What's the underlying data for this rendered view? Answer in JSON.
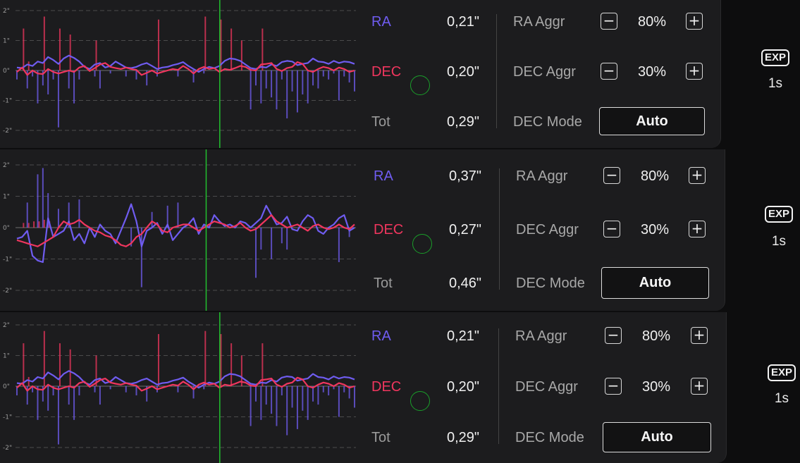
{
  "colors": {
    "ra": "#6f5cf0",
    "dec": "#f0365e",
    "cursor": "#22c02f",
    "grid": "#777777"
  },
  "rows": [
    {
      "chart": {
        "yticks": [
          "2\"",
          "1\"",
          "0\"",
          "-1\"",
          "-2\""
        ],
        "ra_line": [
          0.1,
          0.08,
          0.2,
          0.15,
          0.3,
          0.25,
          0.45,
          0.35,
          0.22,
          0.4,
          0.5,
          0.42,
          0.3,
          0.12,
          0.05,
          0.2,
          0.25,
          0.1,
          0.15,
          0.3,
          0.2,
          0.1,
          0.08,
          0.12,
          0.2,
          0.25,
          0.15,
          0.05,
          0.1,
          0.12,
          0.18,
          0.22,
          0.28,
          0.15,
          0.05,
          -0.05,
          0.05,
          0.12,
          0.08,
          0.15,
          0.32,
          0.4,
          0.38,
          0.32,
          0.2,
          0.08,
          0.05,
          0.12,
          0.1,
          0.2,
          0.15,
          0.28,
          0.32,
          0.3,
          0.18,
          0.22,
          0.25,
          0.4,
          0.3,
          0.28,
          0.22,
          0.32,
          0.25,
          0.3,
          0.28,
          0.22
        ],
        "dec_line": [
          -0.05,
          0.1,
          -0.15,
          0.0,
          -0.1,
          -0.12,
          0.05,
          -0.05,
          -0.1,
          -0.05,
          0.0,
          -0.05,
          0.1,
          0.15,
          -0.02,
          0.08,
          0.2,
          0.25,
          0.12,
          0.08,
          0.05,
          0.1,
          0.05,
          0.02,
          -0.15,
          -0.08,
          0.0,
          -0.1,
          -0.05,
          0.0,
          0.05,
          0.02,
          0.15,
          0.05,
          -0.1,
          0.05,
          0.12,
          0.05,
          0.08,
          -0.05,
          0.05,
          0.02,
          0.08,
          0.15,
          0.12,
          0.02,
          0.0,
          0.2,
          0.22,
          0.25,
          0.05,
          -0.02,
          0.08,
          0.12,
          0.28,
          0.22,
          0.0,
          -0.05,
          0.05,
          0.12,
          0.08,
          0.0,
          0.1,
          0.05,
          -0.05,
          0.0
        ],
        "ra_bars": [
          -0.3,
          0.0,
          -0.6,
          -0.2,
          -1.1,
          -0.5,
          -0.8,
          -0.3,
          -1.9,
          0.0,
          -0.6,
          -1.1,
          -0.3,
          0.0,
          0.0,
          -0.2,
          -0.6,
          0.0,
          -0.1,
          0.0,
          0.0,
          -0.2,
          0.0,
          -0.3,
          0.0,
          -0.5,
          0.0,
          -0.2,
          0.0,
          0.0,
          0.0,
          -0.2,
          0.0,
          0.0,
          -0.4,
          0.0,
          -0.1,
          0.0,
          0.0,
          0.0,
          0.0,
          0.0,
          0.0,
          0.0,
          0.0,
          -1.3,
          -0.5,
          -1.1,
          -0.6,
          -0.9,
          -1.3,
          -0.3,
          -1.6,
          -0.7,
          -1.4,
          -0.8,
          -1.1,
          -0.5,
          -0.6,
          -0.2,
          -0.3,
          -0.1,
          -1.0,
          -0.2,
          -0.4,
          -0.7
        ],
        "dec_bars": [
          0.0,
          1.4,
          0.3,
          0.0,
          0.0,
          1.8,
          0.0,
          0.0,
          1.4,
          0.0,
          1.2,
          0.0,
          0.0,
          0.0,
          0.0,
          1.0,
          0.0,
          0.0,
          0.0,
          0.0,
          0.0,
          0.0,
          0.0,
          0.0,
          0.0,
          0.0,
          0.0,
          1.7,
          0.0,
          0.0,
          0.0,
          0.0,
          0.0,
          0.0,
          0.0,
          0.0,
          1.8,
          0.0,
          0.0,
          1.7,
          0.0,
          1.4,
          0.0,
          1.0,
          0.0,
          0.0,
          0.0,
          1.4,
          0.0,
          0.0,
          0.0,
          0.0,
          0.0,
          0.0,
          0.0,
          0.0,
          0.0,
          0.0,
          0.0,
          0.0,
          0.0,
          0.0,
          0.0,
          0.0,
          0.0,
          0.0
        ],
        "cursor_frac": 0.6
      },
      "ra_label": "RA",
      "ra_value": "0,21\"",
      "dec_label": "DEC",
      "dec_value": "0,20\"",
      "tot_label": "Tot",
      "tot_value": "0,29\"",
      "ra_aggr_label": "RA Aggr",
      "ra_aggr_minus": "−",
      "ra_aggr_value": "80%",
      "ra_aggr_plus": "+",
      "dec_aggr_label": "DEC Aggr",
      "dec_aggr_minus": "−",
      "dec_aggr_value": "30%",
      "dec_aggr_plus": "+",
      "dec_mode_label": "DEC Mode",
      "dec_mode_value": "Auto",
      "exp_icon": "EXP",
      "exp_value": "1s"
    },
    {
      "chart": {
        "yticks": [
          "2\"",
          "1\"",
          "0\"",
          "-1\"",
          "-2\""
        ],
        "ra_line": [
          -0.35,
          -0.3,
          -0.1,
          -0.9,
          -1.05,
          -1.1,
          0.3,
          -0.3,
          -0.2,
          -0.1,
          0.2,
          -0.4,
          -0.2,
          -0.5,
          0.0,
          -0.3,
          0.1,
          -0.1,
          -0.2,
          -0.5,
          -0.1,
          0.3,
          0.75,
          0.2,
          -0.6,
          -0.1,
          0.0,
          0.15,
          -0.2,
          0.1,
          -0.4,
          -0.2,
          0.0,
          0.1,
          0.3,
          -0.2,
          0.1,
          0.0,
          0.4,
          0.2,
          0.05,
          0.1,
          0.0,
          0.2,
          0.15,
          0.0,
          0.15,
          0.3,
          0.7,
          0.4,
          0.1,
          0.15,
          0.35,
          -0.05,
          -0.1,
          0.2,
          0.4,
          0.3,
          -0.1,
          -0.2,
          0.0,
          0.1,
          0.3,
          0.4,
          -0.1,
          0.0
        ],
        "dec_line": [
          -0.4,
          -0.45,
          -0.5,
          -0.55,
          -0.6,
          -0.5,
          -0.4,
          -0.3,
          0.0,
          0.2,
          0.1,
          0.15,
          0.25,
          0.1,
          0.0,
          -0.1,
          -0.15,
          -0.25,
          -0.3,
          -0.4,
          -0.55,
          -0.6,
          -0.5,
          -0.3,
          -0.2,
          0.0,
          0.2,
          0.1,
          -0.1,
          -0.15,
          0.0,
          0.05,
          0.1,
          0.1,
          0.0,
          -0.1,
          0.0,
          0.1,
          0.2,
          0.15,
          0.1,
          0.0,
          0.05,
          0.15,
          0.0,
          -0.1,
          -0.05,
          0.1,
          0.25,
          0.4,
          0.2,
          0.1,
          0.0,
          0.05,
          0.1,
          0.0,
          -0.1,
          0.05,
          0.1,
          0.0,
          -0.05,
          0.0,
          0.1,
          0.0,
          -0.05,
          0.1
        ],
        "ra_bars": [
          0.0,
          0.0,
          0.8,
          0.0,
          1.7,
          1.9,
          1.1,
          0.0,
          0.6,
          0.0,
          0.8,
          0.0,
          0.9,
          0.0,
          0.0,
          0.0,
          0.0,
          0.0,
          0.0,
          0.0,
          0.0,
          0.0,
          -0.6,
          0.0,
          -1.9,
          0.0,
          0.5,
          0.0,
          0.0,
          0.7,
          0.0,
          0.8,
          0.0,
          0.0,
          0.0,
          0.0,
          0.0,
          0.0,
          0.0,
          0.0,
          0.0,
          0.0,
          0.0,
          0.0,
          0.0,
          0.0,
          -1.6,
          -0.7,
          0.0,
          -1.0,
          0.0,
          -0.5,
          -0.7,
          0.0,
          0.0,
          0.0,
          0.0,
          0.0,
          0.0,
          0.0,
          0.0,
          0.0,
          -1.1,
          0.0,
          -0.3,
          0.0
        ],
        "dec_bars": [
          0.0,
          0.15,
          0.15,
          0.2,
          0.2,
          0.25,
          0.2,
          0.0,
          0.0,
          0.0,
          0.0,
          0.0,
          0.0,
          0.0,
          0.0,
          0.0,
          0.0,
          0.0,
          0.0,
          0.0,
          0.0,
          0.0,
          0.0,
          0.0,
          0.0,
          0.0,
          0.0,
          0.0,
          0.0,
          0.0,
          0.0,
          0.0,
          0.0,
          0.0,
          0.0,
          0.0,
          0.0,
          0.0,
          0.0,
          0.0,
          0.0,
          0.0,
          0.0,
          0.0,
          0.0,
          0.0,
          0.0,
          0.0,
          0.0,
          0.0,
          0.0,
          0.0,
          0.0,
          0.0,
          0.0,
          0.0,
          0.0,
          0.0,
          0.0,
          0.0,
          0.0,
          0.0,
          0.0,
          0.0,
          0.0,
          0.0
        ],
        "cursor_frac": 0.56
      },
      "ra_label": "RA",
      "ra_value": "0,37\"",
      "dec_label": "DEC",
      "dec_value": "0,27\"",
      "tot_label": "Tot",
      "tot_value": "0,46\"",
      "ra_aggr_label": "RA Aggr",
      "ra_aggr_minus": "−",
      "ra_aggr_value": "80%",
      "ra_aggr_plus": "+",
      "dec_aggr_label": "DEC Aggr",
      "dec_aggr_minus": "−",
      "dec_aggr_value": "30%",
      "dec_aggr_plus": "+",
      "dec_mode_label": "DEC Mode",
      "dec_mode_value": "Auto",
      "exp_icon": "EXP",
      "exp_value": "1s"
    },
    {
      "chart": {
        "yticks": [
          "2\"",
          "1\"",
          "0\"",
          "-1\"",
          "-2\""
        ],
        "ra_line": [
          0.1,
          0.08,
          0.2,
          0.15,
          0.3,
          0.25,
          0.45,
          0.35,
          0.22,
          0.4,
          0.5,
          0.42,
          0.3,
          0.12,
          0.05,
          0.2,
          0.25,
          0.1,
          0.15,
          0.3,
          0.2,
          0.1,
          0.08,
          0.12,
          0.2,
          0.25,
          0.15,
          0.05,
          0.1,
          0.12,
          0.18,
          0.22,
          0.28,
          0.15,
          0.05,
          -0.05,
          0.05,
          0.12,
          0.08,
          0.15,
          0.32,
          0.4,
          0.38,
          0.32,
          0.2,
          0.08,
          0.05,
          0.12,
          0.1,
          0.2,
          0.15,
          0.28,
          0.32,
          0.3,
          0.18,
          0.22,
          0.25,
          0.4,
          0.3,
          0.28,
          0.22,
          0.32,
          0.25,
          0.3,
          0.28,
          0.22
        ],
        "dec_line": [
          -0.05,
          0.1,
          -0.15,
          0.0,
          -0.1,
          -0.12,
          0.05,
          -0.05,
          -0.1,
          -0.05,
          0.0,
          -0.05,
          0.1,
          0.15,
          -0.02,
          0.08,
          0.2,
          0.25,
          0.12,
          0.08,
          0.05,
          0.1,
          0.05,
          0.02,
          -0.15,
          -0.08,
          0.0,
          -0.1,
          -0.05,
          0.0,
          0.05,
          0.02,
          0.15,
          0.05,
          -0.1,
          0.05,
          0.12,
          0.05,
          0.08,
          -0.05,
          0.05,
          0.02,
          0.08,
          0.15,
          0.12,
          0.02,
          0.0,
          0.2,
          0.22,
          0.25,
          0.05,
          -0.02,
          0.08,
          0.12,
          0.28,
          0.22,
          0.0,
          -0.05,
          0.05,
          0.12,
          0.08,
          0.0,
          0.1,
          0.05,
          -0.05,
          0.0
        ],
        "ra_bars": [
          -0.3,
          0.0,
          -0.6,
          -0.2,
          -1.1,
          -0.5,
          -0.8,
          -0.3,
          -1.9,
          0.0,
          -0.6,
          -1.1,
          -0.3,
          0.0,
          0.0,
          -0.2,
          -0.6,
          0.0,
          -0.1,
          0.0,
          0.0,
          -0.2,
          0.0,
          -0.3,
          0.0,
          -0.5,
          0.0,
          -0.2,
          0.0,
          0.0,
          0.0,
          -0.2,
          0.0,
          0.0,
          -0.4,
          0.0,
          -0.1,
          0.0,
          0.0,
          0.0,
          0.0,
          0.0,
          0.0,
          0.0,
          0.0,
          -1.3,
          -0.5,
          -1.1,
          -0.6,
          -0.9,
          -1.3,
          -0.3,
          -1.6,
          -0.7,
          -1.4,
          -0.8,
          -1.1,
          -0.5,
          -0.6,
          -0.2,
          -0.3,
          -0.1,
          -1.0,
          -0.2,
          -0.4,
          -0.7
        ],
        "dec_bars": [
          0.0,
          1.4,
          0.3,
          0.0,
          0.0,
          1.8,
          0.0,
          0.0,
          1.4,
          0.0,
          1.2,
          0.0,
          0.0,
          0.0,
          0.0,
          1.0,
          0.0,
          0.0,
          0.0,
          0.0,
          0.0,
          0.0,
          0.0,
          0.0,
          0.0,
          0.0,
          0.0,
          1.7,
          0.0,
          0.0,
          0.0,
          0.0,
          0.0,
          0.0,
          0.0,
          0.0,
          1.8,
          0.0,
          0.0,
          1.7,
          0.0,
          1.4,
          0.0,
          1.0,
          0.0,
          0.0,
          0.0,
          1.4,
          0.0,
          0.0,
          0.0,
          0.0,
          0.0,
          0.0,
          0.0,
          0.0,
          0.0,
          0.0,
          0.0,
          0.0,
          0.0,
          0.0,
          0.0,
          0.0,
          0.0,
          0.0
        ],
        "cursor_frac": 0.6
      },
      "ra_label": "RA",
      "ra_value": "0,21\"",
      "dec_label": "DEC",
      "dec_value": "0,20\"",
      "tot_label": "Tot",
      "tot_value": "0,29\"",
      "ra_aggr_label": "RA Aggr",
      "ra_aggr_minus": "−",
      "ra_aggr_value": "80%",
      "ra_aggr_plus": "+",
      "dec_aggr_label": "DEC Aggr",
      "dec_aggr_minus": "−",
      "dec_aggr_value": "30%",
      "dec_aggr_plus": "+",
      "dec_mode_label": "DEC Mode",
      "dec_mode_value": "Auto",
      "exp_icon": "EXP",
      "exp_value": "1s"
    }
  ]
}
